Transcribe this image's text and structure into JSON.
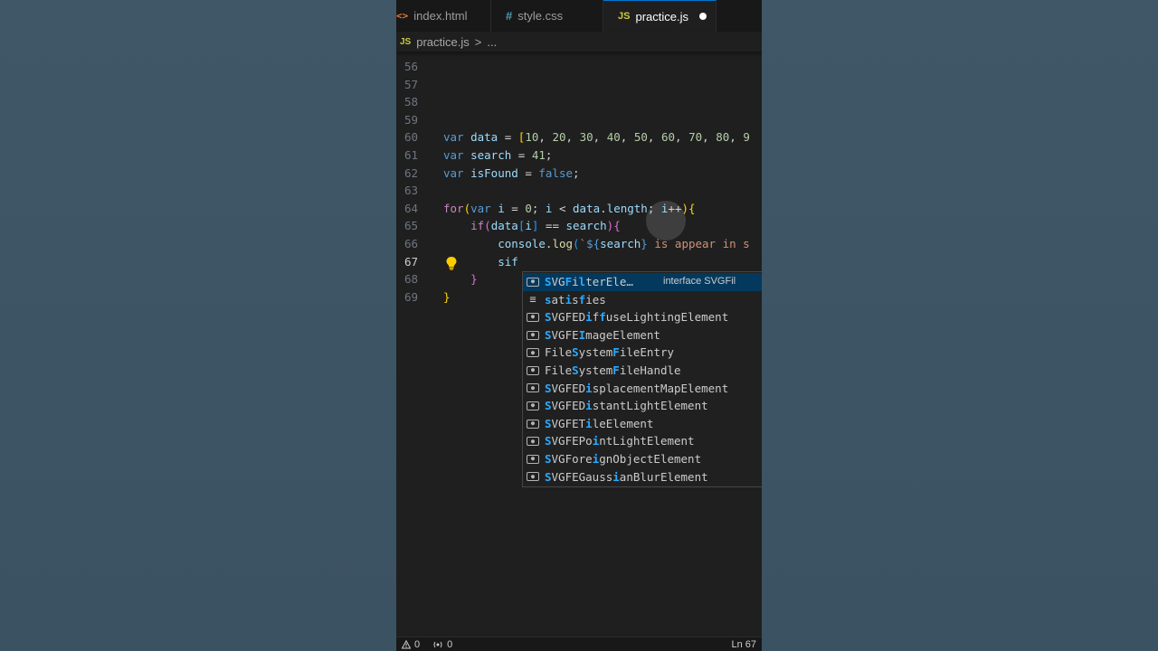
{
  "tabs": [
    {
      "icon": "html-file-icon",
      "glyph": "<>",
      "label": "index.html",
      "active": false
    },
    {
      "icon": "css-file-icon",
      "glyph": "#",
      "label": "style.css",
      "active": false
    },
    {
      "icon": "js-file-icon",
      "glyph": "JS",
      "label": "practice.js",
      "active": true,
      "dirty": true
    }
  ],
  "breadcrumb": {
    "file_glyph": "JS",
    "file": "practice.js",
    "separator": ">",
    "rest": "..."
  },
  "lines": [
    {
      "n": "56",
      "code": []
    },
    {
      "n": "57",
      "code": []
    },
    {
      "n": "58",
      "code": []
    },
    {
      "n": "59",
      "code": []
    },
    {
      "n": "60",
      "code": [
        [
          "kw",
          "var"
        ],
        [
          "plain",
          " "
        ],
        [
          "var",
          "data"
        ],
        [
          "plain",
          " = "
        ],
        [
          "br1",
          "["
        ],
        [
          "num",
          "10"
        ],
        [
          "plain",
          ", "
        ],
        [
          "num",
          "20"
        ],
        [
          "plain",
          ", "
        ],
        [
          "num",
          "30"
        ],
        [
          "plain",
          ", "
        ],
        [
          "num",
          "40"
        ],
        [
          "plain",
          ", "
        ],
        [
          "num",
          "50"
        ],
        [
          "plain",
          ", "
        ],
        [
          "num",
          "60"
        ],
        [
          "plain",
          ", "
        ],
        [
          "num",
          "70"
        ],
        [
          "plain",
          ", "
        ],
        [
          "num",
          "80"
        ],
        [
          "plain",
          ", "
        ],
        [
          "num",
          "9"
        ]
      ]
    },
    {
      "n": "61",
      "code": [
        [
          "kw",
          "var"
        ],
        [
          "plain",
          " "
        ],
        [
          "var",
          "search"
        ],
        [
          "plain",
          " = "
        ],
        [
          "num",
          "41"
        ],
        [
          "plain",
          ";"
        ]
      ]
    },
    {
      "n": "62",
      "code": [
        [
          "kw",
          "var"
        ],
        [
          "plain",
          " "
        ],
        [
          "var",
          "isFound"
        ],
        [
          "plain",
          " = "
        ],
        [
          "kw",
          "false"
        ],
        [
          "plain",
          ";"
        ]
      ]
    },
    {
      "n": "63",
      "code": []
    },
    {
      "n": "64",
      "code": [
        [
          "ctl",
          "for"
        ],
        [
          "br1",
          "("
        ],
        [
          "kw",
          "var"
        ],
        [
          "plain",
          " "
        ],
        [
          "var",
          "i"
        ],
        [
          "plain",
          " = "
        ],
        [
          "num",
          "0"
        ],
        [
          "plain",
          "; "
        ],
        [
          "var",
          "i"
        ],
        [
          "plain",
          " < "
        ],
        [
          "var",
          "data"
        ],
        [
          "plain",
          "."
        ],
        [
          "var",
          "length"
        ],
        [
          "plain",
          "; "
        ],
        [
          "var",
          "i"
        ],
        [
          "plain",
          "++"
        ],
        [
          "br1",
          ")"
        ],
        [
          "br1",
          "{"
        ]
      ]
    },
    {
      "n": "65",
      "code": [
        [
          "plain",
          "    "
        ],
        [
          "ctl",
          "if"
        ],
        [
          "br2",
          "("
        ],
        [
          "var",
          "data"
        ],
        [
          "br3",
          "["
        ],
        [
          "var",
          "i"
        ],
        [
          "br3",
          "]"
        ],
        [
          "plain",
          " == "
        ],
        [
          "var",
          "search"
        ],
        [
          "br2",
          ")"
        ],
        [
          "br2",
          "{"
        ]
      ]
    },
    {
      "n": "66",
      "code": [
        [
          "plain",
          "        "
        ],
        [
          "var",
          "console"
        ],
        [
          "plain",
          "."
        ],
        [
          "fn",
          "log"
        ],
        [
          "br3",
          "("
        ],
        [
          "str",
          "`"
        ],
        [
          "kw",
          "${"
        ],
        [
          "var",
          "search"
        ],
        [
          "kw",
          "}"
        ],
        [
          "str",
          " is appear in s"
        ]
      ]
    },
    {
      "n": "67",
      "code": [
        [
          "plain",
          "        "
        ],
        [
          "var",
          "sif"
        ]
      ],
      "current": true
    },
    {
      "n": "68",
      "code": [
        [
          "plain",
          "    "
        ],
        [
          "br2",
          "}"
        ]
      ]
    },
    {
      "n": "69",
      "code": [
        [
          "br1",
          "}"
        ]
      ]
    }
  ],
  "suggestions": [
    {
      "icon": "variable-icon",
      "parts": [
        [
          "hl",
          "S"
        ],
        [
          "n",
          "VG"
        ],
        [
          "hl",
          "F"
        ],
        [
          "n",
          "i"
        ],
        [
          "hl",
          "l"
        ],
        [
          "n",
          "terEle…"
        ]
      ],
      "detail": "interface SVGFil",
      "selected": true
    },
    {
      "icon": "keyword-icon",
      "parts": [
        [
          "hl",
          "s"
        ],
        [
          "n",
          "at"
        ],
        [
          "hl",
          "i"
        ],
        [
          "n",
          "s"
        ],
        [
          "hl",
          "f"
        ],
        [
          "n",
          "ies"
        ]
      ]
    },
    {
      "icon": "variable-icon",
      "parts": [
        [
          "hl",
          "S"
        ],
        [
          "n",
          "VGFED"
        ],
        [
          "hl",
          "i"
        ],
        [
          "n",
          "f"
        ],
        [
          "hl",
          "f"
        ],
        [
          "n",
          "useLightingElement"
        ]
      ]
    },
    {
      "icon": "variable-icon",
      "parts": [
        [
          "hl",
          "S"
        ],
        [
          "n",
          "VGFE"
        ],
        [
          "hl",
          "I"
        ],
        [
          "n",
          "mageElement"
        ]
      ]
    },
    {
      "icon": "variable-icon",
      "parts": [
        [
          "n",
          "File"
        ],
        [
          "hl",
          "S"
        ],
        [
          "n",
          "ystem"
        ],
        [
          "hl",
          "F"
        ],
        [
          "n",
          "ileEntry"
        ]
      ]
    },
    {
      "icon": "variable-icon",
      "parts": [
        [
          "n",
          "File"
        ],
        [
          "hl",
          "S"
        ],
        [
          "n",
          "ystem"
        ],
        [
          "hl",
          "F"
        ],
        [
          "n",
          "ileHandle"
        ]
      ]
    },
    {
      "icon": "variable-icon",
      "parts": [
        [
          "hl",
          "S"
        ],
        [
          "n",
          "VGFED"
        ],
        [
          "hl",
          "i"
        ],
        [
          "n",
          "splacementMapElement"
        ]
      ]
    },
    {
      "icon": "variable-icon",
      "parts": [
        [
          "hl",
          "S"
        ],
        [
          "n",
          "VGFED"
        ],
        [
          "hl",
          "i"
        ],
        [
          "n",
          "stantLightElement"
        ]
      ]
    },
    {
      "icon": "variable-icon",
      "parts": [
        [
          "hl",
          "S"
        ],
        [
          "n",
          "VGFET"
        ],
        [
          "hl",
          "i"
        ],
        [
          "n",
          "leElement"
        ]
      ]
    },
    {
      "icon": "variable-icon",
      "parts": [
        [
          "hl",
          "S"
        ],
        [
          "n",
          "VGFEPo"
        ],
        [
          "hl",
          "i"
        ],
        [
          "n",
          "ntLightElement"
        ]
      ]
    },
    {
      "icon": "variable-icon",
      "parts": [
        [
          "hl",
          "S"
        ],
        [
          "n",
          "VGFore"
        ],
        [
          "hl",
          "i"
        ],
        [
          "n",
          "gnObjectElement"
        ]
      ]
    },
    {
      "icon": "variable-icon",
      "parts": [
        [
          "hl",
          "S"
        ],
        [
          "n",
          "VGFEGauss"
        ],
        [
          "hl",
          "i"
        ],
        [
          "n",
          "anBlurElement"
        ]
      ]
    }
  ],
  "status": {
    "errors": "0",
    "warnings": "0",
    "position": "Ln 67"
  },
  "colors": {
    "accent": "#0078d4",
    "background": "#1f1f1f",
    "page_bg": "#3d5464"
  }
}
